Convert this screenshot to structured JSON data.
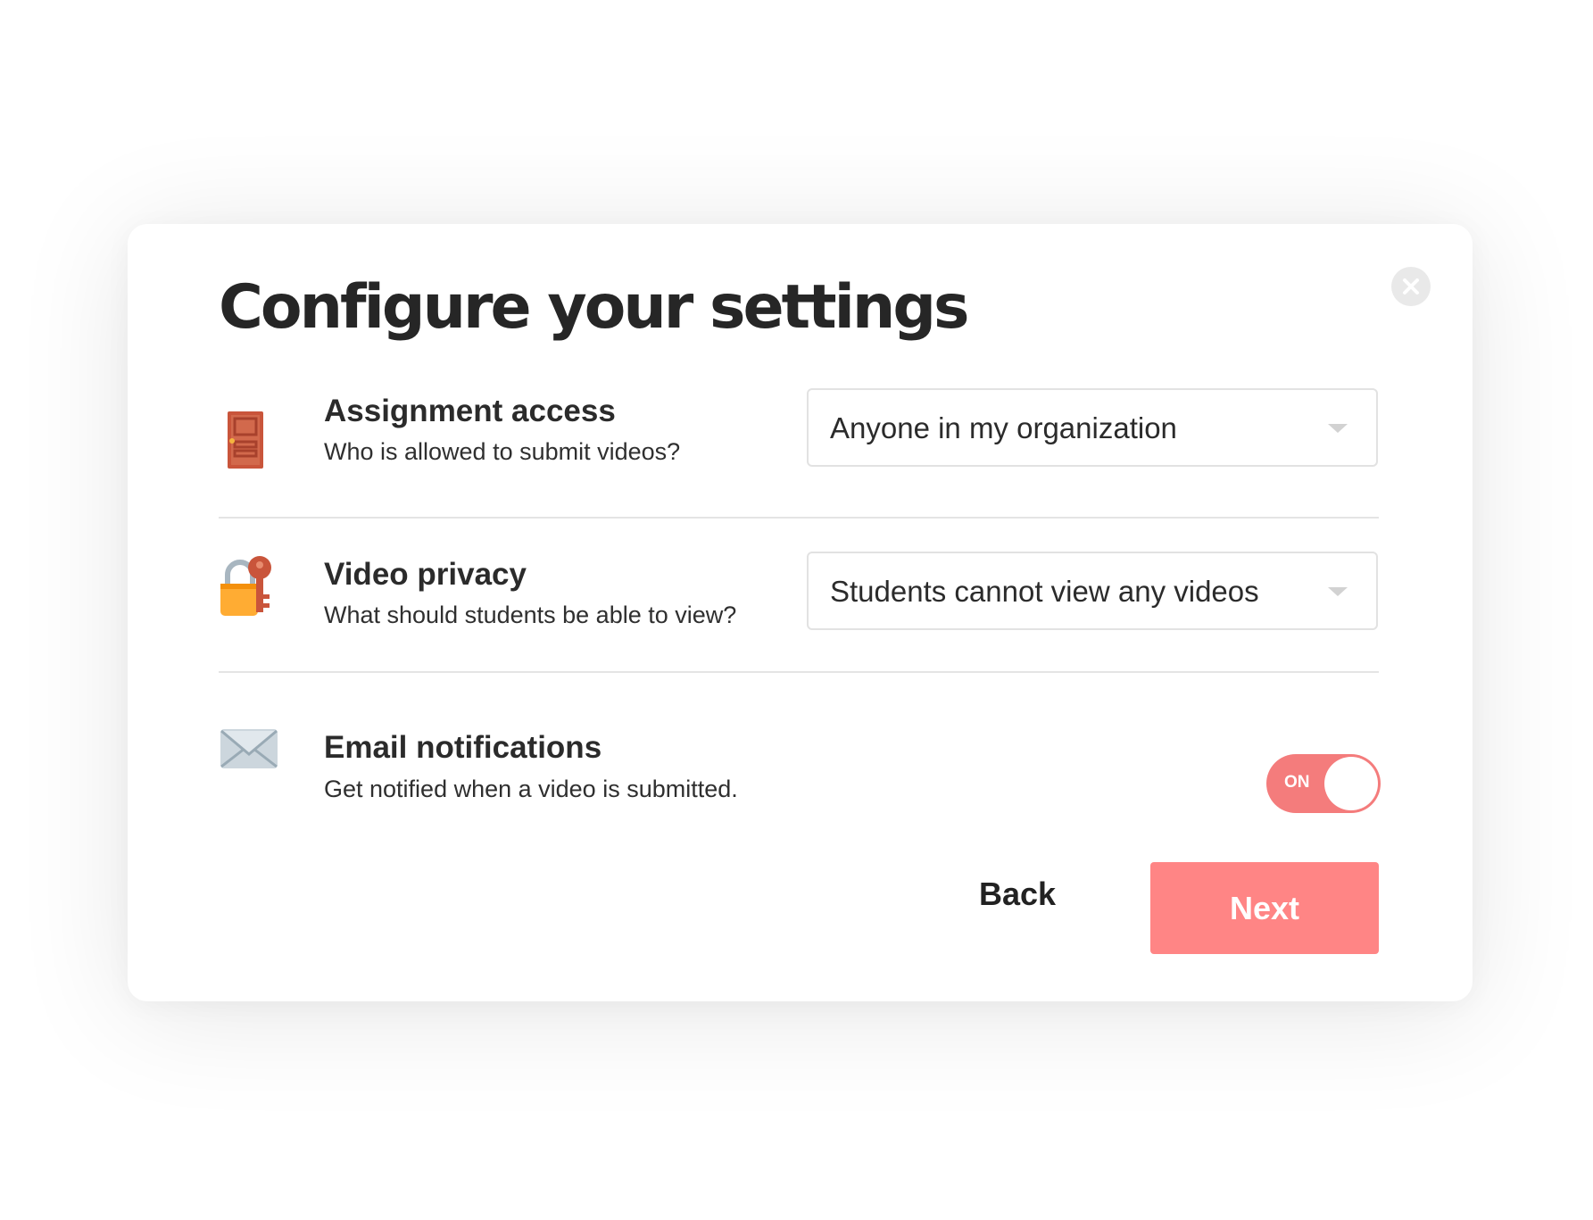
{
  "dialog": {
    "title": "Configure your settings",
    "close_icon": "close-icon"
  },
  "settings": [
    {
      "icon": "door-icon",
      "title": "Assignment access",
      "subtitle": "Who is allowed to submit videos?",
      "control": "select",
      "value": "Anyone in my organization"
    },
    {
      "icon": "lock-with-key-icon",
      "title": "Video privacy",
      "subtitle": "What should students be able to view?",
      "control": "select",
      "value": "Students cannot view any videos"
    },
    {
      "icon": "envelope-icon",
      "title": "Email notifications",
      "subtitle": "Get notified when a video is submitted.",
      "control": "toggle",
      "toggle_label": "ON",
      "toggle_on": true
    }
  ],
  "actions": {
    "back_label": "Back",
    "next_label": "Next"
  },
  "colors": {
    "accent": "#ff8585",
    "toggle_on": "#f47c7c",
    "title_text": "#262626",
    "divider": "#e4e4e4"
  }
}
